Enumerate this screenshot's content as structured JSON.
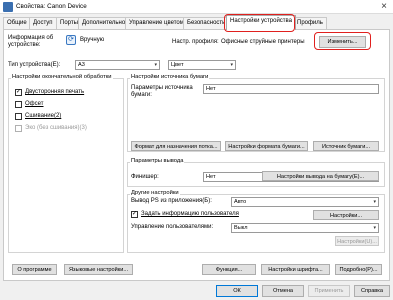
{
  "window": {
    "title": "Свойства: Canon Device",
    "close": "×"
  },
  "tabs": [
    {
      "label": "Общие"
    },
    {
      "label": "Доступ"
    },
    {
      "label": "Порты"
    },
    {
      "label": "Дополнительно"
    },
    {
      "label": "Управление цветом"
    },
    {
      "label": "Безопасность"
    },
    {
      "label": "Настройки устройства"
    },
    {
      "label": "Профиль"
    }
  ],
  "top": {
    "info_label": "Информация об устройстве:",
    "manual_button": "Вручную",
    "profile_label": "Настр. профиля:",
    "profile_value": "Офисные струйные принтеры",
    "change_button": "Изменить..."
  },
  "device_type": {
    "label": "Тип устройства(Е):",
    "value": "A3",
    "color_value": "Цвет"
  },
  "finishing": {
    "title": "Настройки окончательной обработки",
    "duplex": "Двусторонняя печать",
    "offset": "Офсет",
    "staple": "Сшивание(2)",
    "eco": "Эко (без сшивания)(3)"
  },
  "paper_source": {
    "title": "Настройки источника бумаги",
    "source_label": "Параметры источника бумаги:",
    "source_value": "Нет",
    "format_for_feed": "Формат для назначения потка...",
    "paper_format": "Настройки формата бумаги...",
    "source_btn": "Источник бумаги..."
  },
  "output": {
    "title": "Параметры вывода",
    "finisher_label": "Финишер:",
    "finisher_value": "Нет",
    "output_paper_btn": "Настройки вывода на бумагу(Е)..."
  },
  "other": {
    "title": "Другие настройки",
    "ps_label": "Вывод PS из приложения(Б):",
    "ps_value": "Авто",
    "set_user": "Задать информацию пользователя",
    "settings_btn": "Настройки...",
    "user_mgmt_label": "Управление пользователями:",
    "user_mgmt_value": "Выкл",
    "settings_btn_disabled": "Настройки(U)..."
  },
  "bottom_row": {
    "about": "О программе",
    "language": "Языковые настройки...",
    "function": "Функция...",
    "font_settings": "Настройки шрифта...",
    "more": "Подробно(Р)..."
  },
  "footer": {
    "ok": "ОК",
    "cancel": "Отмена",
    "apply": "Применить",
    "help": "Справка"
  }
}
